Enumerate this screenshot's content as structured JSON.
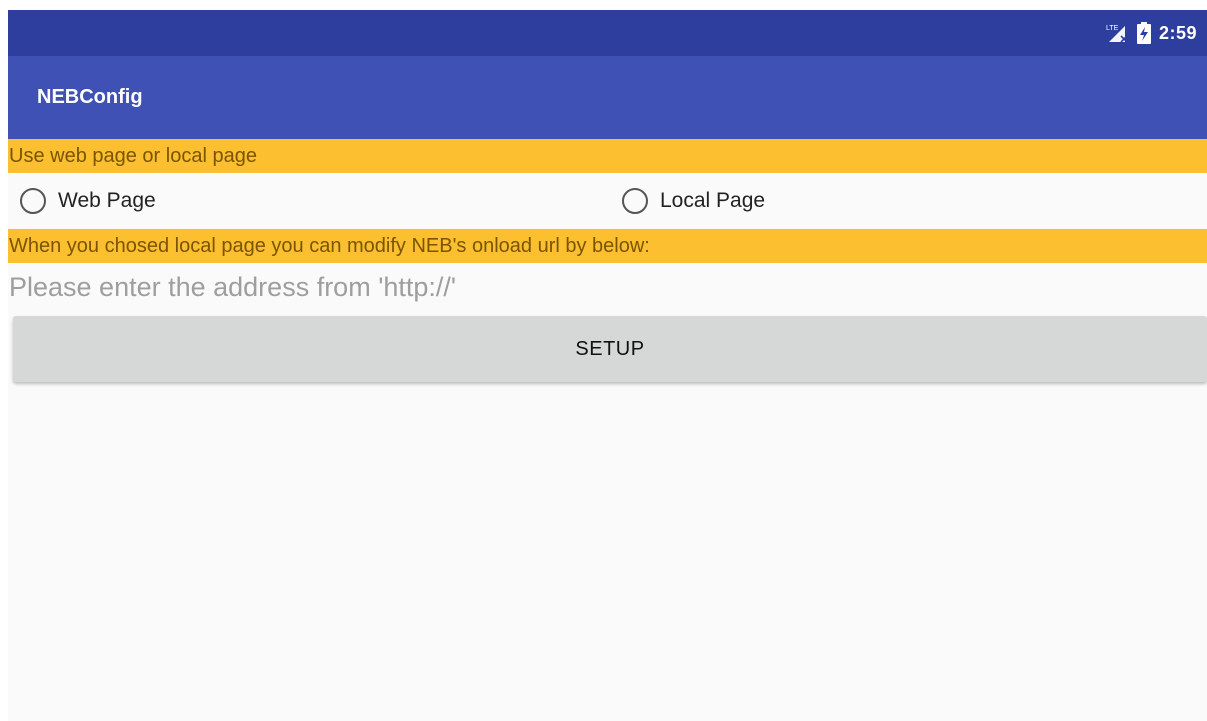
{
  "status_bar": {
    "network_icon": "lte-signal-icon",
    "battery_icon": "battery-charging-icon",
    "time": "2:59",
    "background": "#2d3e9e"
  },
  "app_bar": {
    "title": "NEBConfig",
    "background": "#3f51b5"
  },
  "mode_section": {
    "banner": "Use web page or local page",
    "banner_color": "#fbbf2f",
    "options": [
      {
        "label": "Web Page",
        "selected": false
      },
      {
        "label": "Local Page",
        "selected": false
      }
    ]
  },
  "url_section": {
    "banner": "When you chosed local page you can modify NEB's onload url by below:",
    "input_value": "",
    "input_placeholder": "Please enter the address from 'http://'"
  },
  "actions": {
    "setup_label": "SETUP"
  }
}
